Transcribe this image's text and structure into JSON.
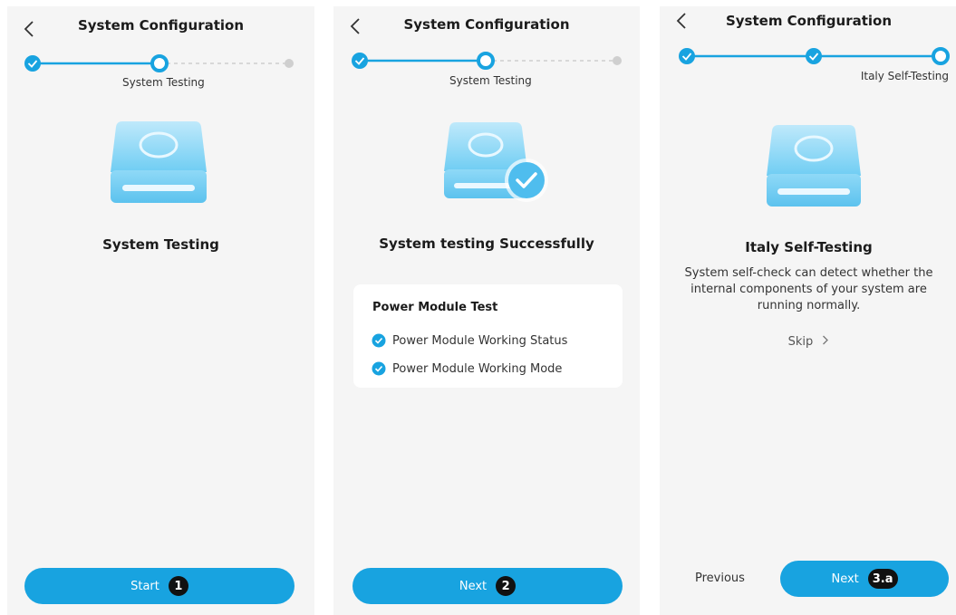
{
  "colors": {
    "accent": "#18a3e0",
    "panel_bg": "#f5f5f5",
    "pending": "#cfcfcf"
  },
  "screens": [
    {
      "header_title": "System Configuration",
      "step_label": "System Testing",
      "heading": "System Testing",
      "button_label": "Start",
      "badge": "1"
    },
    {
      "header_title": "System Configuration",
      "step_label": "System Testing",
      "heading": "System testing Successfully",
      "card": {
        "title": "Power Module Test",
        "items": [
          "Power Module Working Status",
          "Power Module Working Mode"
        ]
      },
      "button_label": "Next",
      "badge": "2"
    },
    {
      "header_title": "System Configuration",
      "step_label": "Italy Self-Testing",
      "heading": "Italy Self-Testing",
      "description": "System self-check can detect whether the internal components of your system are running normally.",
      "skip_label": "Skip",
      "previous_label": "Previous",
      "button_label": "Next",
      "badge": "3.a"
    }
  ]
}
